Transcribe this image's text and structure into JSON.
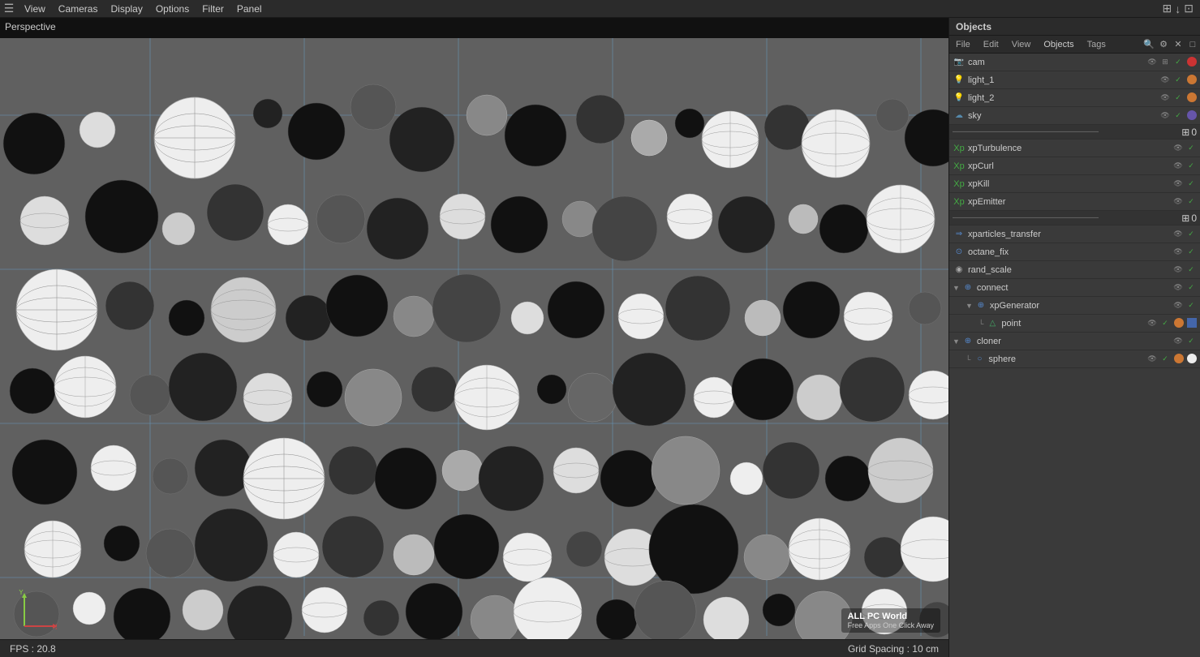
{
  "menubar": {
    "icon": "☰",
    "items": [
      "View",
      "Cameras",
      "Display",
      "Options",
      "Filter",
      "Panel"
    ],
    "right_icons": [
      "⊞",
      "↓",
      "⊡"
    ]
  },
  "viewport": {
    "label": "Perspective",
    "fps_label": "FPS : 20.8",
    "grid_label": "Grid Spacing : 10 cm"
  },
  "panel": {
    "title": "Objects",
    "tabs": [
      "File",
      "Edit",
      "View",
      "Objects",
      "Tags"
    ],
    "search_icon": "🔍",
    "objects": [
      {
        "id": "cam",
        "name": "cam",
        "icon_color": "#5588aa",
        "indent": 0,
        "has_expand": false,
        "controls": [
          "eye",
          "check",
          "dot"
        ],
        "dot_color": "#cc3333"
      },
      {
        "id": "light_1",
        "name": "light_1",
        "icon_color": "#888",
        "indent": 0,
        "has_expand": false,
        "controls": [
          "eye",
          "check",
          "dot"
        ],
        "dot_color": "#cc7733"
      },
      {
        "id": "light_2",
        "name": "light_2",
        "icon_color": "#888",
        "indent": 0,
        "has_expand": false,
        "controls": [
          "eye",
          "check",
          "dot"
        ],
        "dot_color": "#cc7733"
      },
      {
        "id": "sky",
        "name": "sky",
        "icon_color": "#5588aa",
        "indent": 0,
        "has_expand": false,
        "controls": [
          "eye",
          "check",
          "dot"
        ],
        "dot_color": "#6655aa"
      },
      {
        "id": "sep1",
        "type": "separator"
      },
      {
        "id": "xpTurbulence",
        "name": "xpTurbulence",
        "icon_color": "#44aa44",
        "indent": 0,
        "has_expand": false,
        "controls": [
          "eye",
          "check"
        ],
        "dot_color": null
      },
      {
        "id": "xpCurl",
        "name": "xpCurl",
        "icon_color": "#44aa44",
        "indent": 0,
        "has_expand": false,
        "controls": [
          "eye",
          "check"
        ],
        "dot_color": null
      },
      {
        "id": "xpKill",
        "name": "xpKill",
        "icon_color": "#44aa44",
        "indent": 0,
        "has_expand": false,
        "controls": [
          "eye",
          "check"
        ],
        "dot_color": null
      },
      {
        "id": "xpEmitter",
        "name": "xpEmitter",
        "icon_color": "#44aa44",
        "indent": 0,
        "has_expand": false,
        "controls": [
          "eye",
          "check"
        ],
        "dot_color": null
      },
      {
        "id": "sep2",
        "type": "separator"
      },
      {
        "id": "xparticles_transfer",
        "name": "xparticles_transfer",
        "icon_color": "#5588cc",
        "indent": 0,
        "has_expand": false,
        "controls": [
          "eye",
          "check"
        ],
        "dot_color": null
      },
      {
        "id": "octane_fix",
        "name": "octane_fix",
        "icon_color": "#5588cc",
        "indent": 0,
        "has_expand": false,
        "controls": [
          "eye",
          "check"
        ],
        "dot_color": null
      },
      {
        "id": "rand_scale",
        "name": "rand_scale",
        "icon_color": "#aaa",
        "indent": 0,
        "has_expand": false,
        "controls": [
          "eye",
          "check"
        ],
        "dot_color": null
      },
      {
        "id": "connect",
        "name": "connect",
        "icon_color": "#5588cc",
        "indent": 0,
        "has_expand": true,
        "expanded": true,
        "controls": [
          "eye",
          "check"
        ],
        "dot_color": null
      },
      {
        "id": "xpGenerator",
        "name": "xpGenerator",
        "icon_color": "#5588cc",
        "indent": 1,
        "has_expand": true,
        "expanded": true,
        "controls": [
          "eye",
          "check"
        ],
        "dot_color": null
      },
      {
        "id": "point",
        "name": "point",
        "icon_color": "#44aa66",
        "indent": 2,
        "has_expand": false,
        "controls": [
          "eye",
          "check"
        ],
        "dot_color": "#cc7733",
        "dot2_color": "#4466aa"
      },
      {
        "id": "cloner",
        "name": "cloner",
        "icon_color": "#5588cc",
        "indent": 0,
        "has_expand": true,
        "expanded": true,
        "controls": [
          "eye",
          "check"
        ],
        "dot_color": null
      },
      {
        "id": "sphere",
        "name": "sphere",
        "icon_color": "#5588cc",
        "indent": 1,
        "has_expand": false,
        "controls": [
          "eye",
          "check"
        ],
        "dot_color": "#cc7733",
        "dot2_color": "#eee"
      }
    ]
  },
  "axes": {
    "y_label": "Y",
    "x_label": "X"
  }
}
